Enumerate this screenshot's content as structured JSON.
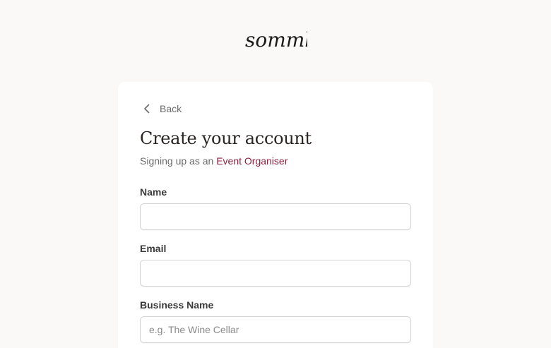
{
  "brand": {
    "logo_text": "sommly"
  },
  "nav": {
    "back_label": "Back"
  },
  "form": {
    "title": "Create your account",
    "subtitle_prefix": "Signing up as an",
    "role": "Event Organiser",
    "fields": [
      {
        "label": "Name",
        "value": "",
        "placeholder": ""
      },
      {
        "label": "Email",
        "value": "",
        "placeholder": ""
      },
      {
        "label": "Business Name",
        "value": "",
        "placeholder": "e.g. The Wine Cellar"
      }
    ]
  },
  "colors": {
    "background": "#faf9f7",
    "card": "#ffffff",
    "accent": "#8c1f3d",
    "muted_text": "#6b6b6b"
  }
}
